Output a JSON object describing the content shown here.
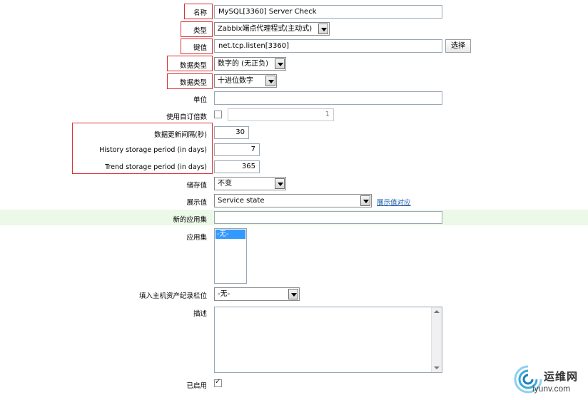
{
  "form": {
    "name": {
      "label": "名称",
      "value": "MySQL[3360] Server Check"
    },
    "type": {
      "label": "类型",
      "value": "Zabbix端点代理程式(主动式)"
    },
    "key": {
      "label": "键值",
      "value": "net.tcp.listen[3360]",
      "button": "选择"
    },
    "info_type": {
      "label": "数据类型",
      "value": "数字的 (无正负)"
    },
    "data_type": {
      "label": "数据类型",
      "value": "十进位数字"
    },
    "units": {
      "label": "单位",
      "value": ""
    },
    "multiplier": {
      "label": "使用自订倍数",
      "value": "1",
      "checked": false
    },
    "update_interval": {
      "label": "数据更新间隔(秒)",
      "value": "30"
    },
    "history": {
      "label": "History storage period (in days)",
      "value": "7"
    },
    "trends": {
      "label": "Trend storage period (in days)",
      "value": "365"
    },
    "store_value": {
      "label": "储存值",
      "value": "不变"
    },
    "show_value": {
      "label": "展示值",
      "value": "Service state",
      "link": "展示值对应"
    },
    "new_application": {
      "label": "新的应用集",
      "value": ""
    },
    "applications": {
      "label": "应用集",
      "options": [
        "-无-"
      ]
    },
    "inventory_field": {
      "label": "填入主机资产纪录栏位",
      "value": "-无-"
    },
    "description": {
      "label": "描述",
      "value": ""
    },
    "enabled": {
      "label": "已启用",
      "checked": true
    }
  },
  "watermark": {
    "cn": "运维网",
    "url": "iyunv.com"
  },
  "colors": {
    "annotation": "#d9343a",
    "highlight_row": "#ecf8e8",
    "accent": "#3399ff"
  }
}
